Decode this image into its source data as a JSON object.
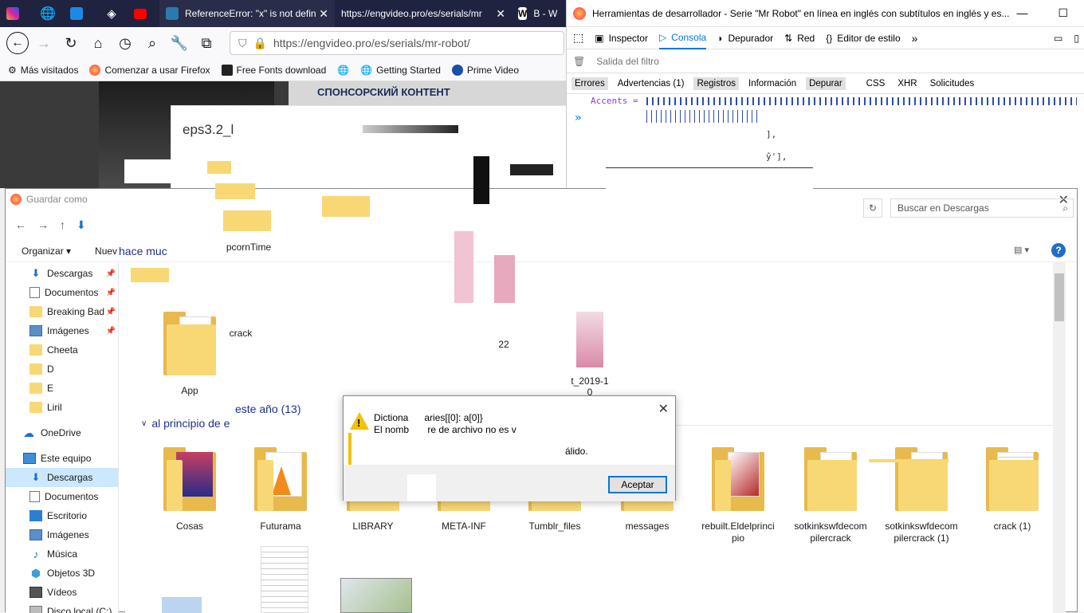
{
  "browser": {
    "tabs": [
      {
        "label": "",
        "icon": "instagram-icon",
        "color": "#d6249f"
      },
      {
        "label": "",
        "icon": "globe-icon",
        "color": "#ffffff"
      },
      {
        "label": "",
        "icon": "site-icon",
        "color": "#1e88e5"
      },
      {
        "label": "",
        "icon": "codepen-icon",
        "color": "#ffffff"
      },
      {
        "label": "",
        "icon": "youtube-icon",
        "color": "#ff0000"
      },
      {
        "label": "ReferenceError: \"x\" is not defin",
        "icon": "mdn-icon",
        "color": "#2a7ab0"
      },
      {
        "label": "https://engvideo.pro/es/serials/mr",
        "icon": "",
        "color": ""
      },
      {
        "label": "B - W",
        "icon": "wikipedia-icon",
        "color": "#ffffff"
      }
    ],
    "url": "https://engvideo.pro/es/serials/mr-robot/",
    "bookmarks": [
      "Más visitados",
      "Comenzar a usar Firefox",
      "Free Fonts download",
      "Getting Started",
      "Prime Video"
    ]
  },
  "webpage": {
    "sponsor_text": "СПОНСОРСКИЙ КОНТЕНТ",
    "popup_title": "eps3.2_l"
  },
  "devtools": {
    "title": "Herramientas de desarrollador - Serie \"Mr Robot\" en línea en inglés con subtítulos en inglés y es...",
    "tabs": [
      "Inspector",
      "Consola",
      "Depurador",
      "Red",
      "Editor de estilo"
    ],
    "filter_placeholder": "Salida del filtro",
    "levels": [
      "Errores",
      "Advertencias (1)",
      "Registros",
      "Información",
      "Depurar",
      "CSS",
      "XHR",
      "Solicitudes"
    ],
    "console_lines": [
      "Accents =",
      "],",
      "ŷ'],",
      "»"
    ]
  },
  "save_dialog": {
    "title": "Guardar como",
    "search_placeholder": "Buscar en Descargas",
    "toolbar": {
      "organize": "Organizar",
      "new": "Nuev"
    },
    "nav": [
      {
        "label": "Descargas",
        "pinned": true,
        "icon": "download-icon"
      },
      {
        "label": "Documentos",
        "pinned": true,
        "icon": "document-icon"
      },
      {
        "label": "Breaking Bad",
        "pinned": true,
        "icon": "folder-icon"
      },
      {
        "label": "Imágenes",
        "pinned": true,
        "icon": "pictures-icon"
      },
      {
        "label": "Cheeta",
        "pinned": false,
        "icon": "folder-icon"
      },
      {
        "label": "D",
        "pinned": false,
        "icon": "folder-icon"
      },
      {
        "label": "E",
        "pinned": false,
        "icon": "folder-icon"
      },
      {
        "label": "Liril",
        "pinned": false,
        "icon": "folder-icon"
      },
      {
        "label": "OneDrive",
        "pinned": false,
        "icon": "cloud-icon"
      },
      {
        "label": "Este equipo",
        "pinned": false,
        "icon": "computer-icon"
      },
      {
        "label": "Descargas",
        "pinned": false,
        "icon": "download-icon",
        "selected": true
      },
      {
        "label": "Documentos",
        "pinned": false,
        "icon": "document-icon"
      },
      {
        "label": "Escritorio",
        "pinned": false,
        "icon": "desktop-icon"
      },
      {
        "label": "Imágenes",
        "pinned": false,
        "icon": "pictures-icon"
      },
      {
        "label": "Música",
        "pinned": false,
        "icon": "music-icon"
      },
      {
        "label": "Objetos 3D",
        "pinned": false,
        "icon": "cube-icon"
      },
      {
        "label": "Vídeos",
        "pinned": false,
        "icon": "video-icon"
      },
      {
        "label": "Disco local (C:)",
        "pinned": false,
        "icon": "drive-icon"
      }
    ],
    "group_earlier": "hace muc",
    "group_this_year": "este año (13)",
    "group_beginning": "al principio de e",
    "top_files": [
      {
        "name": "pcornTime"
      },
      {
        "name": "App"
      },
      {
        "name": "crack"
      },
      {
        "name": "22"
      },
      {
        "name": "t_2019-1\n0"
      }
    ],
    "files": [
      {
        "name": "Cosas"
      },
      {
        "name": "Futurama"
      },
      {
        "name": "LIBRARY"
      },
      {
        "name": "META-INF"
      },
      {
        "name": "Tumblr_files"
      },
      {
        "name": "messages"
      },
      {
        "name": "rebuilt.Eldelprinci\npio"
      },
      {
        "name": "sotkinkswfdecom\npilercrack"
      },
      {
        "name": "sotkinkswfdecom\npilercrack (1)"
      },
      {
        "name": "crack (1)"
      }
    ]
  },
  "error_dialog": {
    "line1": "Dictiona      aries[[0]: a[0]}",
    "line2": "El nomb       re de archivo no es v",
    "line3": "álido.",
    "ok_label": "Aceptar"
  }
}
